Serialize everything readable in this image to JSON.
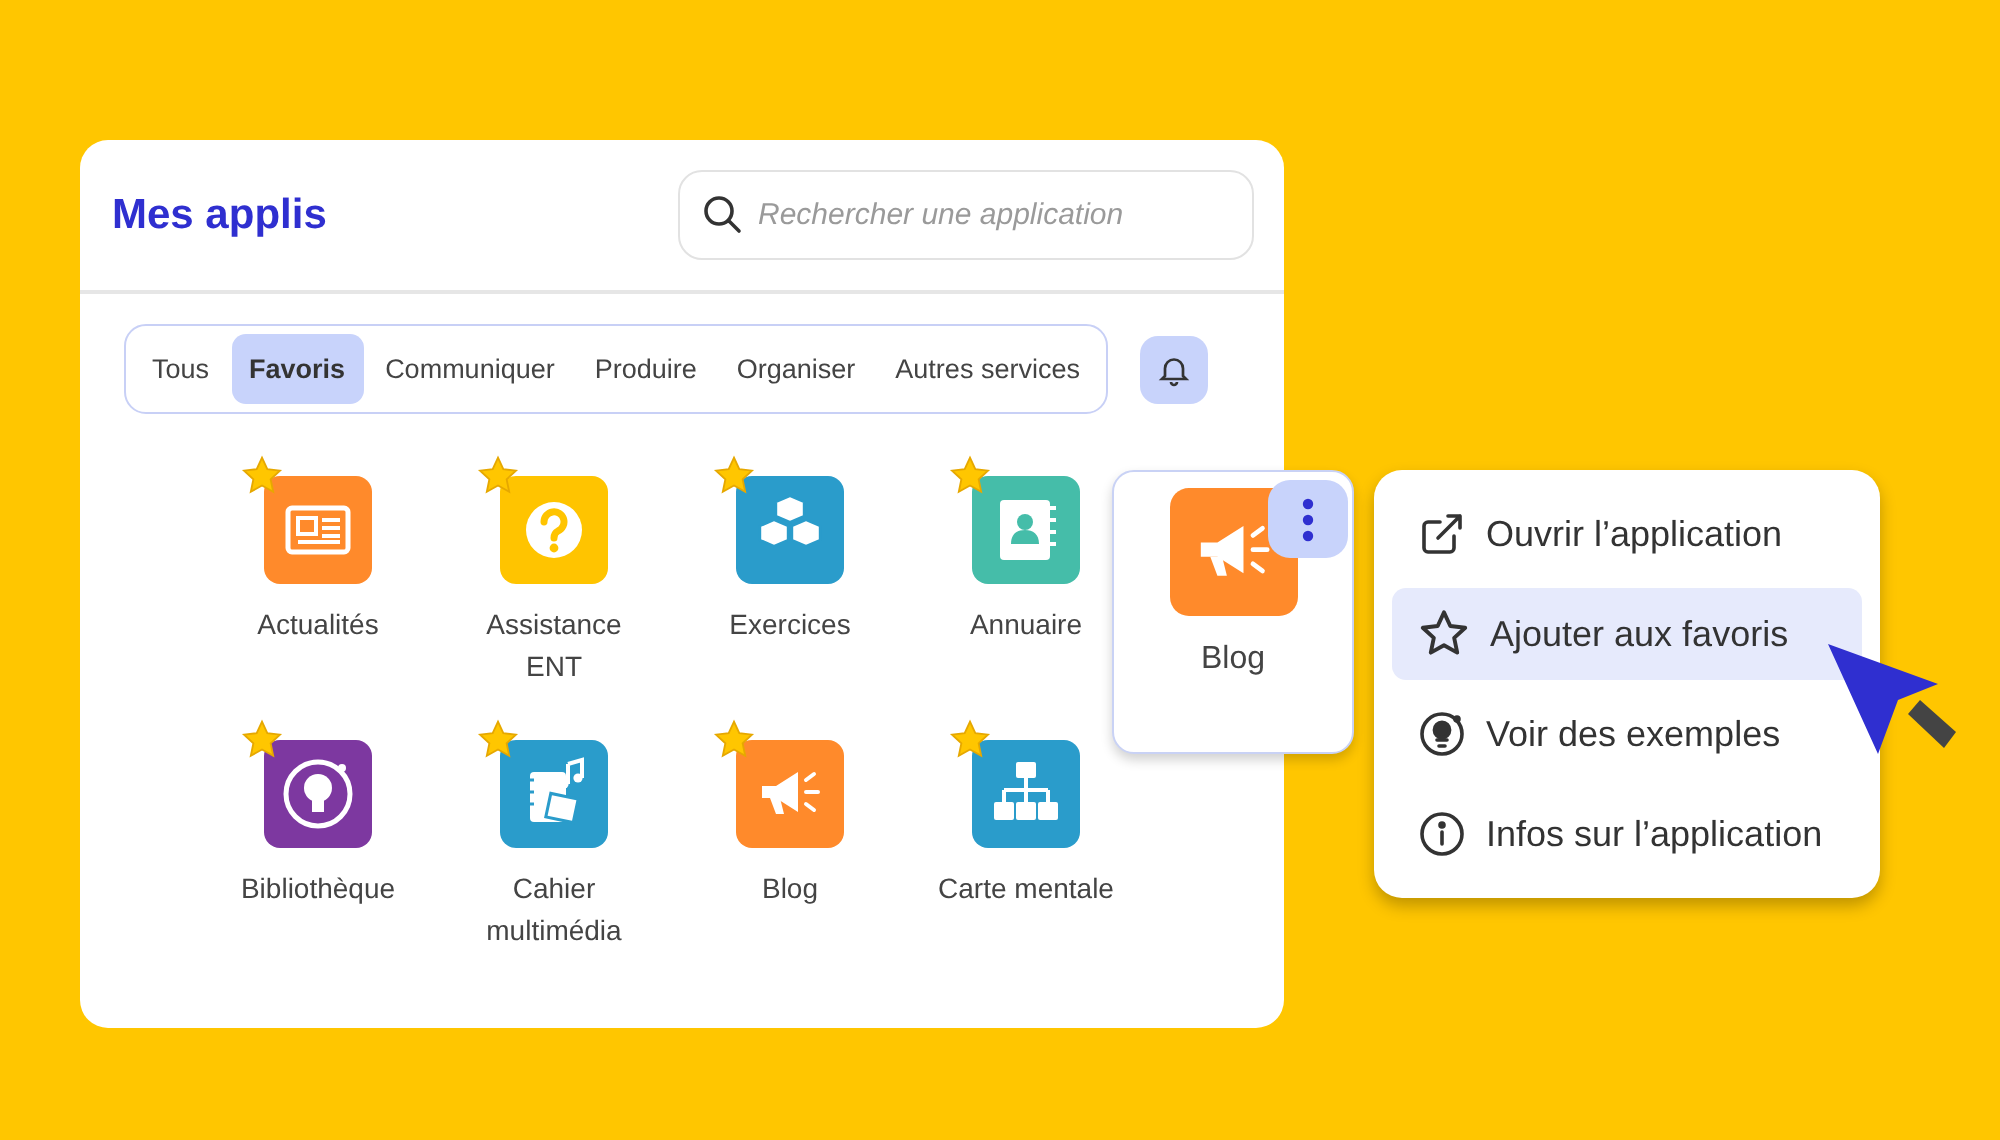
{
  "panel": {
    "title": "Mes applis",
    "search": {
      "placeholder": "Rechercher une application"
    }
  },
  "tabs": [
    {
      "label": "Tous",
      "selected": false
    },
    {
      "label": "Favoris",
      "selected": true
    },
    {
      "label": "Communiquer",
      "selected": false
    },
    {
      "label": "Produire",
      "selected": false
    },
    {
      "label": "Organiser",
      "selected": false
    },
    {
      "label": "Autres services",
      "selected": false
    }
  ],
  "apps": [
    {
      "name": "Actualités",
      "kind": "newspaper",
      "color": "#ff8a2b",
      "favorite": true
    },
    {
      "name": "Assistance ENT",
      "kind": "question",
      "color": "#ffc400",
      "favorite": true
    },
    {
      "name": "Exercices",
      "kind": "cubes",
      "color": "#2a9ccb",
      "favorite": true
    },
    {
      "name": "Annuaire",
      "kind": "contacts",
      "color": "#45bda9",
      "favorite": true
    },
    {
      "name": "Bibliothèque",
      "kind": "bulb",
      "color": "#7d38a0",
      "favorite": true
    },
    {
      "name": "Cahier multimédia",
      "kind": "notebook",
      "color": "#2a9ccb",
      "favorite": true
    },
    {
      "name": "Blog",
      "kind": "megaphone",
      "color": "#ff8a2b",
      "favorite": true
    },
    {
      "name": "Carte mentale",
      "kind": "orgchart",
      "color": "#2a9ccb",
      "favorite": true
    }
  ],
  "focused_app": {
    "name": "Blog",
    "kind": "megaphone",
    "color": "#ff8a2b"
  },
  "menu": [
    {
      "label": "Ouvrir l’application",
      "kind": "external",
      "selected": false
    },
    {
      "label": "Ajouter aux favoris",
      "kind": "star",
      "selected": true
    },
    {
      "label": "Voir des exemples",
      "kind": "bulb",
      "selected": false
    },
    {
      "label": "Infos sur l’application",
      "kind": "info",
      "selected": false
    }
  ]
}
